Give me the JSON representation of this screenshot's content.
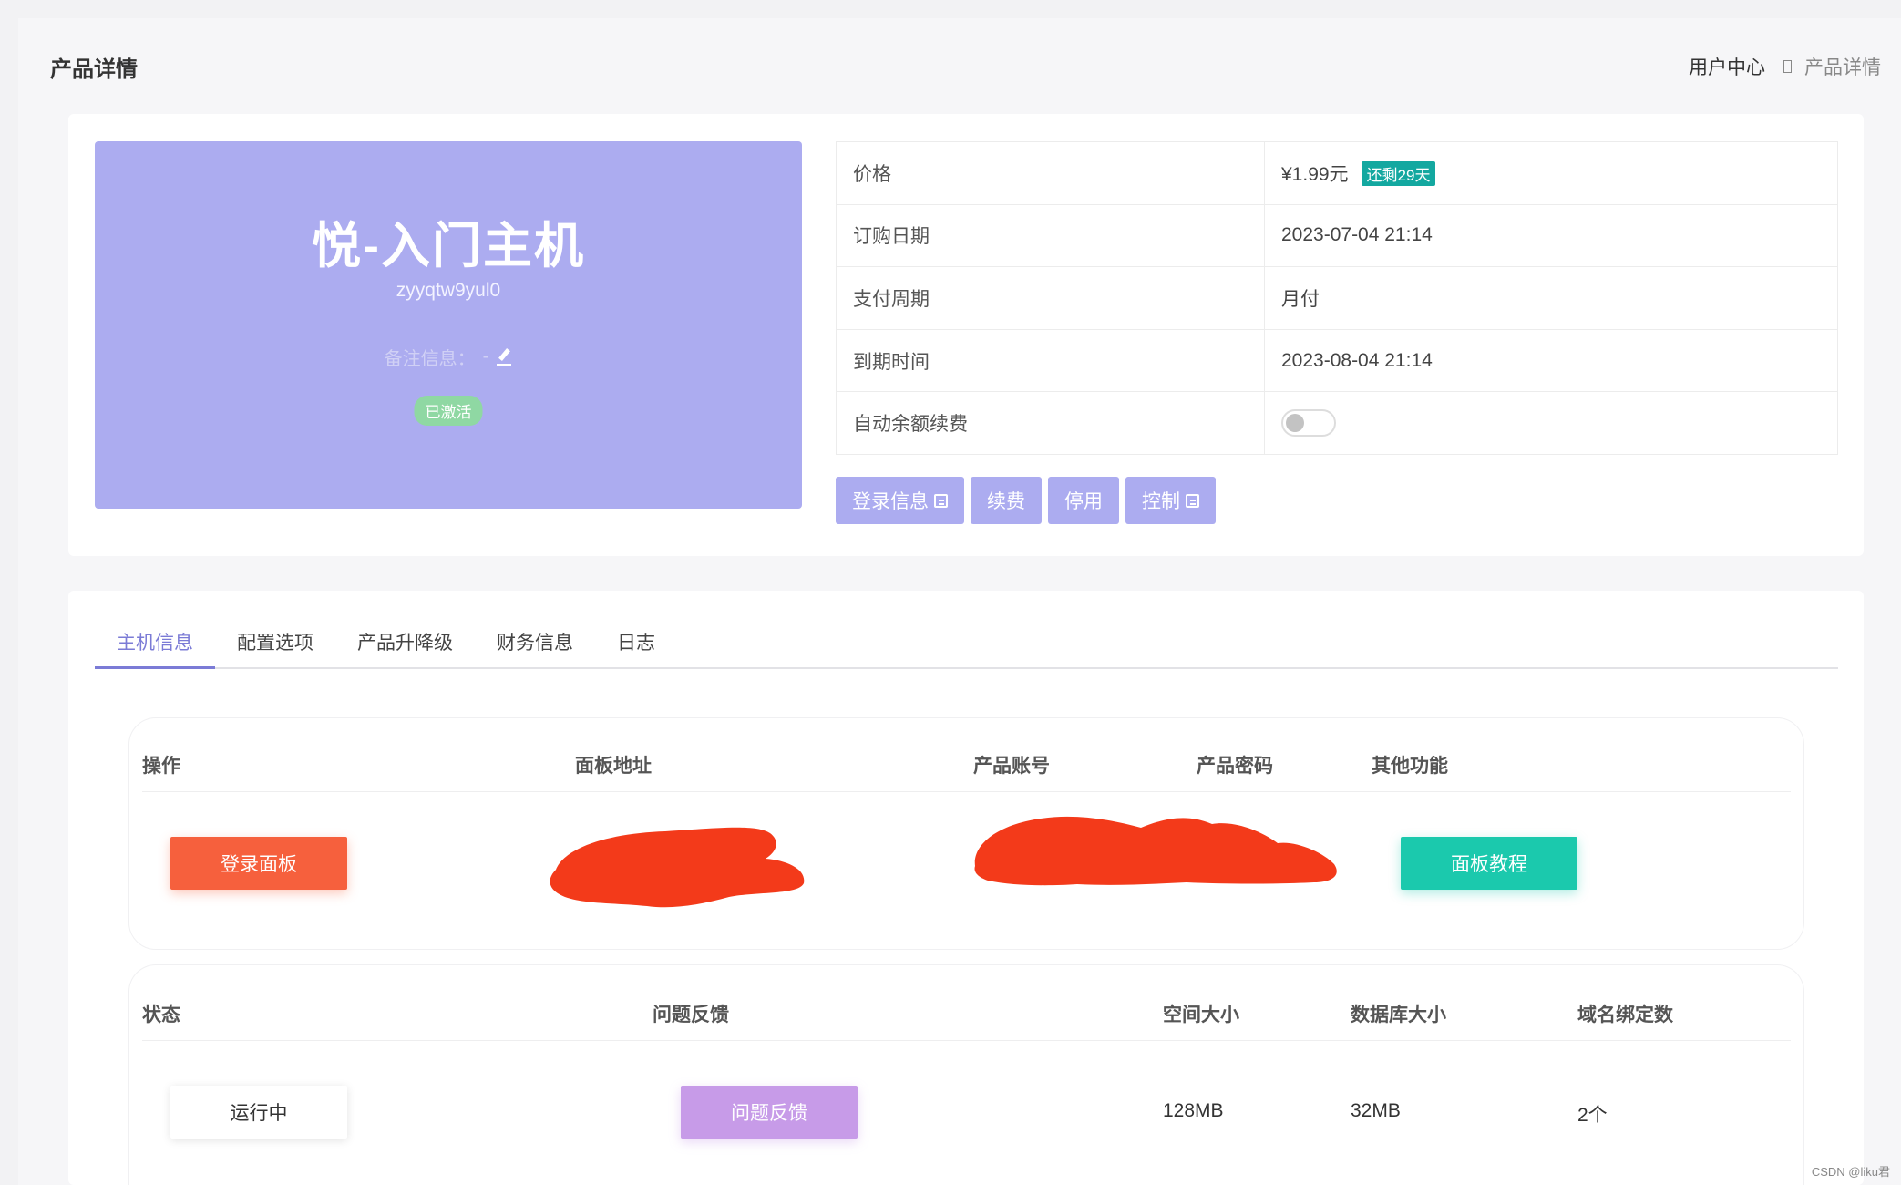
{
  "header": {
    "page_title": "产品详情",
    "breadcrumb": {
      "home": "用户中心",
      "current": "产品详情"
    }
  },
  "product": {
    "name": "悦-入门主机",
    "id": "zyyqtw9yul0",
    "remark_label": "备注信息：",
    "remark_value": "-",
    "status_badge": "已激活"
  },
  "info": {
    "rows": [
      {
        "key": "价格",
        "value": "¥1.99元",
        "tag": "还剩29天"
      },
      {
        "key": "订购日期",
        "value": "2023-07-04 21:14"
      },
      {
        "key": "支付周期",
        "value": "月付"
      },
      {
        "key": "到期时间",
        "value": "2023-08-04 21:14"
      },
      {
        "key": "自动余额续费",
        "toggle_on": false
      }
    ]
  },
  "actions": {
    "login_info": "登录信息",
    "renew": "续费",
    "disable": "停用",
    "control": "控制"
  },
  "tabs": [
    "主机信息",
    "配置选项",
    "产品升降级",
    "财务信息",
    "日志"
  ],
  "active_tab": 0,
  "panel1": {
    "headers": [
      "操作",
      "面板地址",
      "产品账号",
      "产品密码",
      "其他功能"
    ],
    "login_button": "登录面板",
    "tutorial_button": "面板教程",
    "redact_color": "#f33a1a"
  },
  "panel2": {
    "headers": [
      "状态",
      "问题反馈",
      "空间大小",
      "数据库大小",
      "域名绑定数"
    ],
    "status_button": "运行中",
    "feedback_button": "问题反馈",
    "space": "128MB",
    "db_size": "32MB",
    "domains": "2个"
  },
  "colors": {
    "accent_purple": "#acacf0",
    "login_orange": "#f6603d",
    "tutorial_teal": "#1bc9ad",
    "feedback_lilac": "#c79be8",
    "remaining_tag": "#13a8a0"
  },
  "watermark": "CSDN @liku君"
}
